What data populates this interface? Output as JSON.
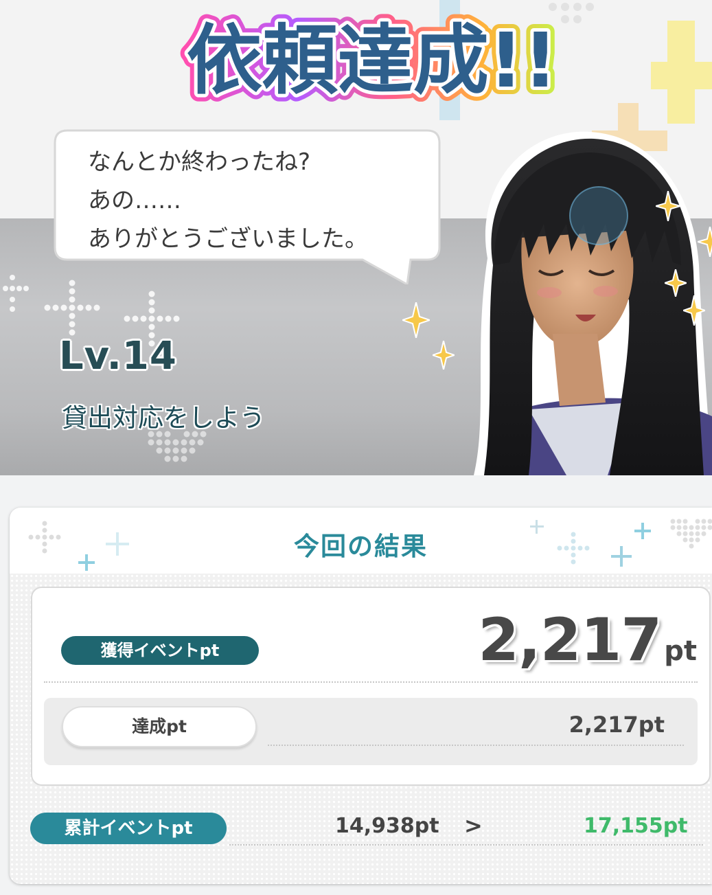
{
  "banner": {
    "title": "依頼達成!!"
  },
  "dialogue": {
    "lines": [
      "なんとか終わったね?",
      "あの……",
      "ありがとうございました。"
    ]
  },
  "quest": {
    "level": "Lv.14",
    "name": "貸出対応をしよう"
  },
  "results": {
    "title": "今回の結果",
    "earned": {
      "label": "獲得イベントpt",
      "value": "2,217",
      "unit": "pt"
    },
    "achievement": {
      "label": "達成pt",
      "value": "2,217pt"
    },
    "total": {
      "label": "累計イベントpt",
      "before": "14,938pt",
      "arrow": ">",
      "after": "17,155pt"
    }
  },
  "colors": {
    "teal_dark": "#1f6670",
    "teal": "#2a8a9a",
    "green_value": "#3fba6a",
    "text_dark": "#484848"
  }
}
